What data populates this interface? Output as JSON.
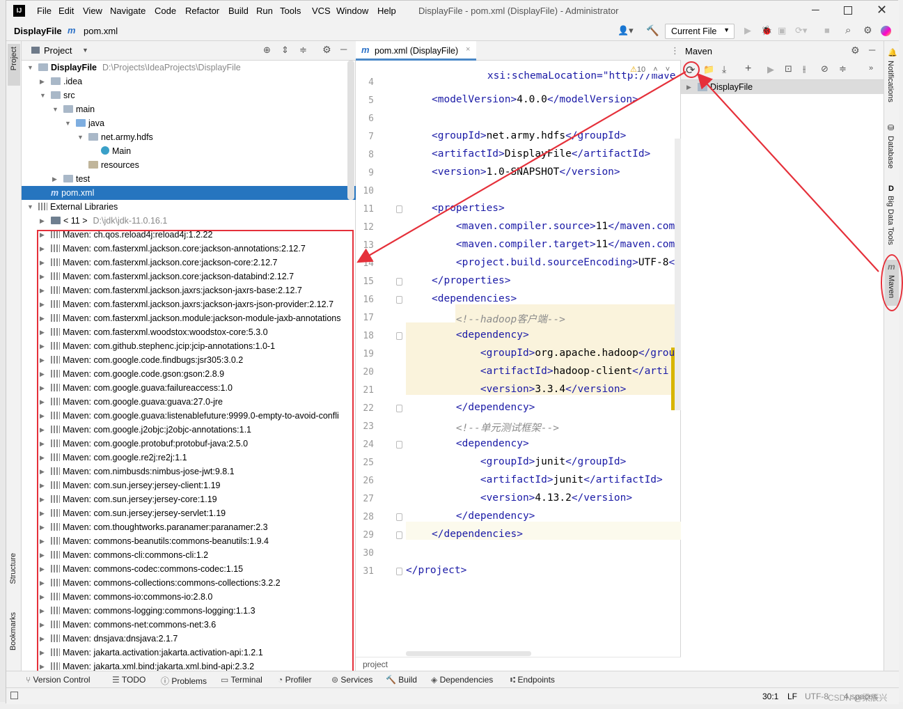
{
  "title_bar": {
    "menus": [
      "File",
      "Edit",
      "View",
      "Navigate",
      "Code",
      "Refactor",
      "Build",
      "Run",
      "Tools",
      "VCS",
      "Window",
      "Help"
    ],
    "window_title": "DisplayFile - pom.xml (DisplayFile) - Administrator",
    "app_icon_letters": "IJ"
  },
  "nav": {
    "project": "DisplayFile",
    "file": "pom.xml",
    "run_config": "Current File"
  },
  "left_stripe": {
    "project": "Project",
    "structure": "Structure",
    "bookmarks": "Bookmarks"
  },
  "project_panel": {
    "title": "Project",
    "tree": [
      {
        "label": "DisplayFile",
        "extra": "D:\\Projects\\IdeaProjects\\DisplayFile"
      },
      {
        "label": ".idea"
      },
      {
        "label": "src"
      },
      {
        "label": "main"
      },
      {
        "label": "java"
      },
      {
        "label": "net.army.hdfs"
      },
      {
        "label": "Main"
      },
      {
        "label": "resources"
      },
      {
        "label": "test"
      },
      {
        "label": "pom.xml"
      },
      {
        "label": "External Libraries"
      },
      {
        "label": "< 11 >",
        "extra": "D:\\jdk\\jdk-11.0.16.1"
      }
    ],
    "libraries": [
      "Maven: ch.qos.reload4j:reload4j:1.2.22",
      "Maven: com.fasterxml.jackson.core:jackson-annotations:2.12.7",
      "Maven: com.fasterxml.jackson.core:jackson-core:2.12.7",
      "Maven: com.fasterxml.jackson.core:jackson-databind:2.12.7",
      "Maven: com.fasterxml.jackson.jaxrs:jackson-jaxrs-base:2.12.7",
      "Maven: com.fasterxml.jackson.jaxrs:jackson-jaxrs-json-provider:2.12.7",
      "Maven: com.fasterxml.jackson.module:jackson-module-jaxb-annotations",
      "Maven: com.fasterxml.woodstox:woodstox-core:5.3.0",
      "Maven: com.github.stephenc.jcip:jcip-annotations:1.0-1",
      "Maven: com.google.code.findbugs:jsr305:3.0.2",
      "Maven: com.google.code.gson:gson:2.8.9",
      "Maven: com.google.guava:failureaccess:1.0",
      "Maven: com.google.guava:guava:27.0-jre",
      "Maven: com.google.guava:listenablefuture:9999.0-empty-to-avoid-confli",
      "Maven: com.google.j2objc:j2objc-annotations:1.1",
      "Maven: com.google.protobuf:protobuf-java:2.5.0",
      "Maven: com.google.re2j:re2j:1.1",
      "Maven: com.nimbusds:nimbus-jose-jwt:9.8.1",
      "Maven: com.sun.jersey:jersey-client:1.19",
      "Maven: com.sun.jersey:jersey-core:1.19",
      "Maven: com.sun.jersey:jersey-servlet:1.19",
      "Maven: com.thoughtworks.paranamer:paranamer:2.3",
      "Maven: commons-beanutils:commons-beanutils:1.9.4",
      "Maven: commons-cli:commons-cli:1.2",
      "Maven: commons-codec:commons-codec:1.15",
      "Maven: commons-collections:commons-collections:3.2.2",
      "Maven: commons-io:commons-io:2.8.0",
      "Maven: commons-logging:commons-logging:1.1.3",
      "Maven: commons-net:commons-net:3.6",
      "Maven: dnsjava:dnsjava:2.1.7",
      "Maven: jakarta.activation:jakarta.activation-api:1.2.1",
      "Maven: jakarta.xml.bind:jakarta.xml.bind-api:2.3.2"
    ]
  },
  "editor": {
    "tab": "pom.xml (DisplayFile)",
    "warnings": "10",
    "lines": [
      {
        "n": "4",
        "parts": [
          [
            "t",
            "    xsi:schemaLocation=\"http://maven.apache.org/"
          ]
        ]
      },
      {
        "n": "5",
        "parts": [
          [
            "t",
            "<modelVersion>"
          ],
          [
            "x",
            "4.0.0"
          ],
          [
            "t",
            "</modelVersion>"
          ]
        ]
      },
      {
        "n": "6",
        "parts": []
      },
      {
        "n": "7",
        "parts": [
          [
            "t",
            "<groupId>"
          ],
          [
            "x",
            "net.army.hdfs"
          ],
          [
            "t",
            "</groupId>"
          ]
        ]
      },
      {
        "n": "8",
        "parts": [
          [
            "t",
            "<artifactId>"
          ],
          [
            "x",
            "DisplayFile"
          ],
          [
            "t",
            "</artifactId>"
          ]
        ]
      },
      {
        "n": "9",
        "parts": [
          [
            "t",
            "<version>"
          ],
          [
            "x",
            "1.0-SNAPSHOT"
          ],
          [
            "t",
            "</version>"
          ]
        ]
      },
      {
        "n": "10",
        "parts": []
      },
      {
        "n": "11",
        "parts": [
          [
            "t",
            "<properties>"
          ]
        ]
      },
      {
        "n": "12",
        "parts": [
          [
            "x",
            "    "
          ],
          [
            "t",
            "<maven.compiler.source>"
          ],
          [
            "x",
            "11"
          ],
          [
            "t",
            "</maven.com"
          ]
        ]
      },
      {
        "n": "13",
        "parts": [
          [
            "x",
            "    "
          ],
          [
            "t",
            "<maven.compiler.target>"
          ],
          [
            "x",
            "11"
          ],
          [
            "t",
            "</maven.com"
          ]
        ]
      },
      {
        "n": "14",
        "parts": [
          [
            "x",
            "    "
          ],
          [
            "t",
            "<project.build.sourceEncoding>"
          ],
          [
            "x",
            "UTF-8"
          ],
          [
            "t",
            "<"
          ]
        ]
      },
      {
        "n": "15",
        "parts": [
          [
            "t",
            "</properties>"
          ]
        ]
      },
      {
        "n": "16",
        "parts": [
          [
            "t",
            "<dependencies>"
          ]
        ]
      },
      {
        "n": "17",
        "parts": [
          [
            "x",
            "    "
          ],
          [
            "c",
            "<!--hadoop客户端-->"
          ]
        ]
      },
      {
        "n": "18",
        "parts": [
          [
            "x",
            "    "
          ],
          [
            "t",
            "<dependency>"
          ]
        ]
      },
      {
        "n": "19",
        "parts": [
          [
            "x",
            "        "
          ],
          [
            "t",
            "<groupId>"
          ],
          [
            "x",
            "org.apache.hadoop"
          ],
          [
            "t",
            "</grou"
          ]
        ]
      },
      {
        "n": "20",
        "parts": [
          [
            "x",
            "        "
          ],
          [
            "t",
            "<artifactId>"
          ],
          [
            "x",
            "hadoop-client"
          ],
          [
            "t",
            "</arti"
          ]
        ]
      },
      {
        "n": "21",
        "parts": [
          [
            "x",
            "        "
          ],
          [
            "t",
            "<version>"
          ],
          [
            "x",
            "3.3.4"
          ],
          [
            "t",
            "</version>"
          ]
        ]
      },
      {
        "n": "22",
        "parts": [
          [
            "x",
            "    "
          ],
          [
            "t",
            "</dependency>"
          ]
        ]
      },
      {
        "n": "23",
        "parts": [
          [
            "x",
            "    "
          ],
          [
            "c",
            "<!--单元测试框架-->"
          ]
        ]
      },
      {
        "n": "24",
        "parts": [
          [
            "x",
            "    "
          ],
          [
            "t",
            "<dependency>"
          ]
        ]
      },
      {
        "n": "25",
        "parts": [
          [
            "x",
            "        "
          ],
          [
            "t",
            "<groupId>"
          ],
          [
            "x",
            "junit"
          ],
          [
            "t",
            "</groupId>"
          ]
        ]
      },
      {
        "n": "26",
        "parts": [
          [
            "x",
            "        "
          ],
          [
            "t",
            "<artifactId>"
          ],
          [
            "x",
            "junit"
          ],
          [
            "t",
            "</artifactId>"
          ]
        ]
      },
      {
        "n": "27",
        "parts": [
          [
            "x",
            "        "
          ],
          [
            "t",
            "<version>"
          ],
          [
            "x",
            "4.13.2"
          ],
          [
            "t",
            "</version>"
          ]
        ]
      },
      {
        "n": "28",
        "parts": [
          [
            "x",
            "    "
          ],
          [
            "t",
            "</dependency>"
          ]
        ]
      },
      {
        "n": "29",
        "parts": [
          [
            "t",
            "</dependencies>"
          ]
        ]
      },
      {
        "n": "30",
        "parts": []
      },
      {
        "n": "31",
        "parts": [
          [
            "t",
            "</project>"
          ]
        ]
      }
    ],
    "breadcrumb": "project"
  },
  "maven_panel": {
    "title": "Maven",
    "project": "DisplayFile"
  },
  "right_stripe": {
    "notifications": "Notifications",
    "database": "Database",
    "bigdata": "Big Data Tools",
    "maven": "Maven"
  },
  "bottom_tools": [
    "Version Control",
    "TODO",
    "Problems",
    "Terminal",
    "Profiler",
    "Services",
    "Build",
    "Dependencies",
    "Endpoints"
  ],
  "status": {
    "position": "30:1",
    "line_sep": "LF",
    "encoding": "UTF-8",
    "indent": "4 spaces",
    "watermark": "CSDN @梁辰兴"
  }
}
